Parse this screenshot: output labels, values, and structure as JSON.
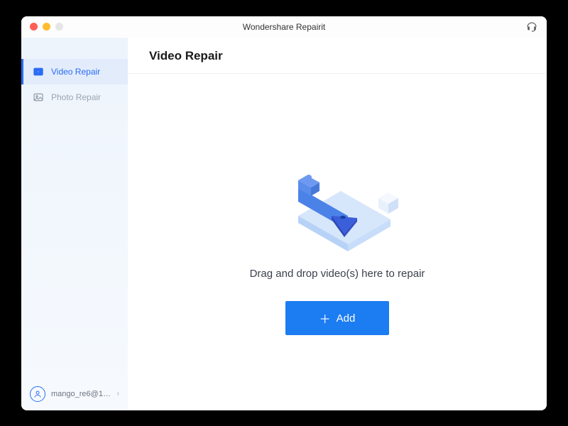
{
  "window": {
    "title": "Wondershare Repairit"
  },
  "sidebar": {
    "items": [
      {
        "label": "Video Repair",
        "icon": "video-icon",
        "active": true
      },
      {
        "label": "Photo Repair",
        "icon": "photo-icon",
        "active": false
      }
    ]
  },
  "account": {
    "name": "mango_re6@163...."
  },
  "main": {
    "title": "Video Repair",
    "drop_text": "Drag and drop video(s) here to repair",
    "add_button_label": "Add"
  },
  "colors": {
    "accent": "#1c7cf2"
  }
}
